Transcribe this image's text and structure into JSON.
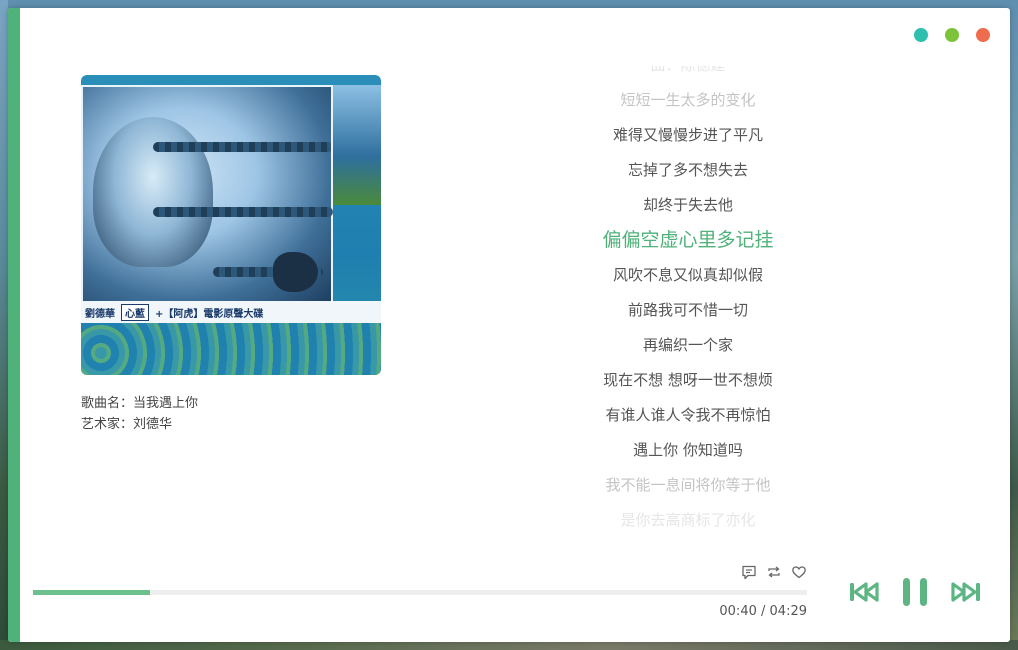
{
  "window": {
    "controls": [
      "minimize",
      "maximize",
      "close"
    ],
    "accent_color": "#4fb27a"
  },
  "album_cover": {
    "artist_text": "劉德華",
    "album_word": "心藍",
    "subtitle": "+【阿虎】電影原聲大碟"
  },
  "song": {
    "title_label": "歌曲名：",
    "title": "当我遇上你",
    "artist_label": "艺术家：",
    "artist": "刘德华"
  },
  "lyrics": {
    "lines": [
      "曲：陈德建",
      "短短一生太多的变化",
      "难得又慢慢步进了平凡",
      "忘掉了多不想失去",
      "却终于失去他",
      "偏偏空虚心里多记挂",
      "风吹不息又似真却似假",
      "前路我可不惜一切",
      "再编织一个家",
      "现在不想 想呀一世不想烦",
      "有谁人谁人令我不再惊怕",
      "遇上你 你知道吗",
      "我不能一息间将你等于他",
      "是你去高商标了亦化"
    ],
    "active_index": 5
  },
  "player": {
    "progress": 0.151,
    "current_time": "00:40",
    "separator": "/",
    "duration": "04:29",
    "icons": [
      "comment-icon",
      "repeat-icon",
      "like-icon"
    ],
    "controls": [
      "previous-icon",
      "pause-icon",
      "next-icon"
    ],
    "control_color": "#5db584"
  }
}
